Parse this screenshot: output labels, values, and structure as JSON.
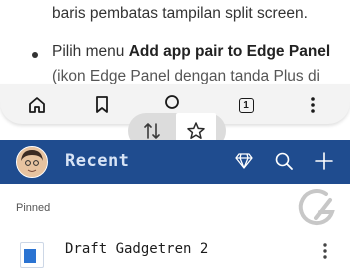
{
  "article": {
    "line1": "baris pembatas tampilan split screen.",
    "line2_prefix": "Pilih menu ",
    "line2_bold": "Add app pair to Edge Panel",
    "line3": "(ikon Edge Panel dengan tanda Plus di"
  },
  "browser_toolbar": {
    "tab_count": "1",
    "icons": [
      "home-icon",
      "bookmark-icon",
      "search-icon",
      "tabs-icon",
      "more-vertical-icon"
    ]
  },
  "split_handle": {
    "icons": [
      "swap-vertical-icon",
      "star-icon"
    ]
  },
  "app_header": {
    "title": "Recent",
    "icons": [
      "diamond-icon",
      "search-icon",
      "plus-icon"
    ],
    "background": "#1f4c8f"
  },
  "list": {
    "section_label": "Pinned",
    "items": [
      {
        "title": "Draft Gadgetren 2"
      }
    ]
  },
  "watermark": {
    "icon": "gadgetren-logo-icon"
  }
}
